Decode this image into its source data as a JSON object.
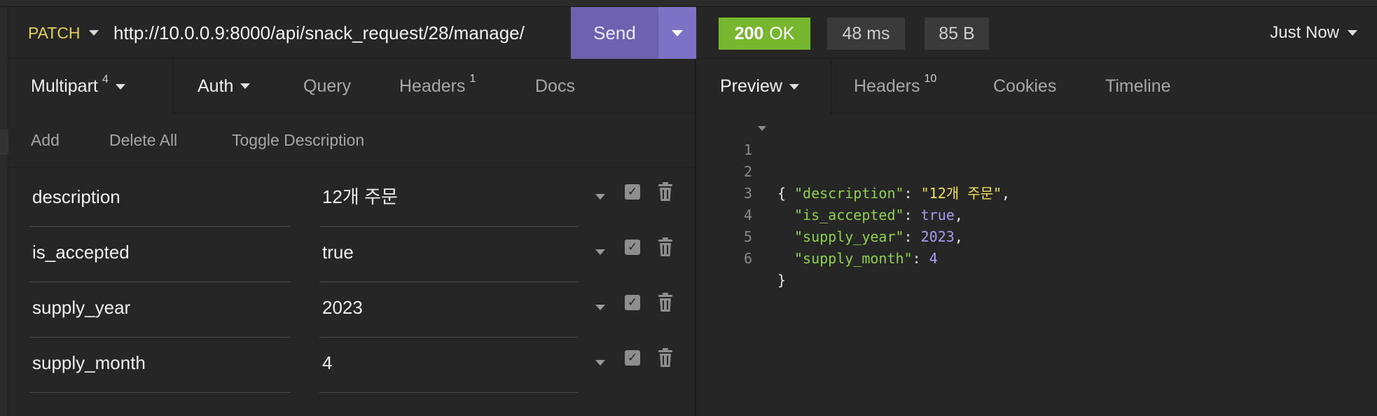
{
  "request": {
    "method": "PATCH",
    "url": "http://10.0.0.9:8000/api/snack_request/28/manage/",
    "send_label": "Send"
  },
  "request_tabs": [
    {
      "label": "Multipart",
      "badge": "4"
    },
    {
      "label": "Auth"
    },
    {
      "label": "Query"
    },
    {
      "label": "Headers",
      "badge": "1"
    },
    {
      "label": "Docs"
    }
  ],
  "param_actions": {
    "add": "Add",
    "delete_all": "Delete All",
    "toggle_description": "Toggle Description"
  },
  "params": [
    {
      "name": "description",
      "value": "12개 주문",
      "enabled": true
    },
    {
      "name": "is_accepted",
      "value": "true",
      "enabled": true
    },
    {
      "name": "supply_year",
      "value": "2023",
      "enabled": true
    },
    {
      "name": "supply_month",
      "value": "4",
      "enabled": true
    }
  ],
  "response": {
    "status_code": "200",
    "status_text": "OK",
    "time": "48 ms",
    "size": "85 B",
    "history_label": "Just Now"
  },
  "response_tabs": [
    {
      "label": "Preview"
    },
    {
      "label": "Headers",
      "badge": "10"
    },
    {
      "label": "Cookies"
    },
    {
      "label": "Timeline"
    }
  ],
  "response_body": {
    "line_numbers": [
      "1",
      "2",
      "3",
      "4",
      "5",
      "6"
    ],
    "open_brace": "{",
    "close_brace": "}",
    "fields": [
      {
        "key": "\"description\"",
        "value": "\"12개 주문\"",
        "type": "string",
        "comma": ","
      },
      {
        "key": "\"is_accepted\"",
        "value": "true",
        "type": "literal",
        "comma": ","
      },
      {
        "key": "\"supply_year\"",
        "value": "2023",
        "type": "literal",
        "comma": ","
      },
      {
        "key": "\"supply_month\"",
        "value": "4",
        "type": "literal",
        "comma": ""
      }
    ]
  },
  "colors": {
    "method": "#e2d35a",
    "send_button": "#6e62b0",
    "status_ok": "#77b72f",
    "json_key": "#8fd14f",
    "json_string": "#f1e05a",
    "json_literal": "#a99cf0"
  }
}
